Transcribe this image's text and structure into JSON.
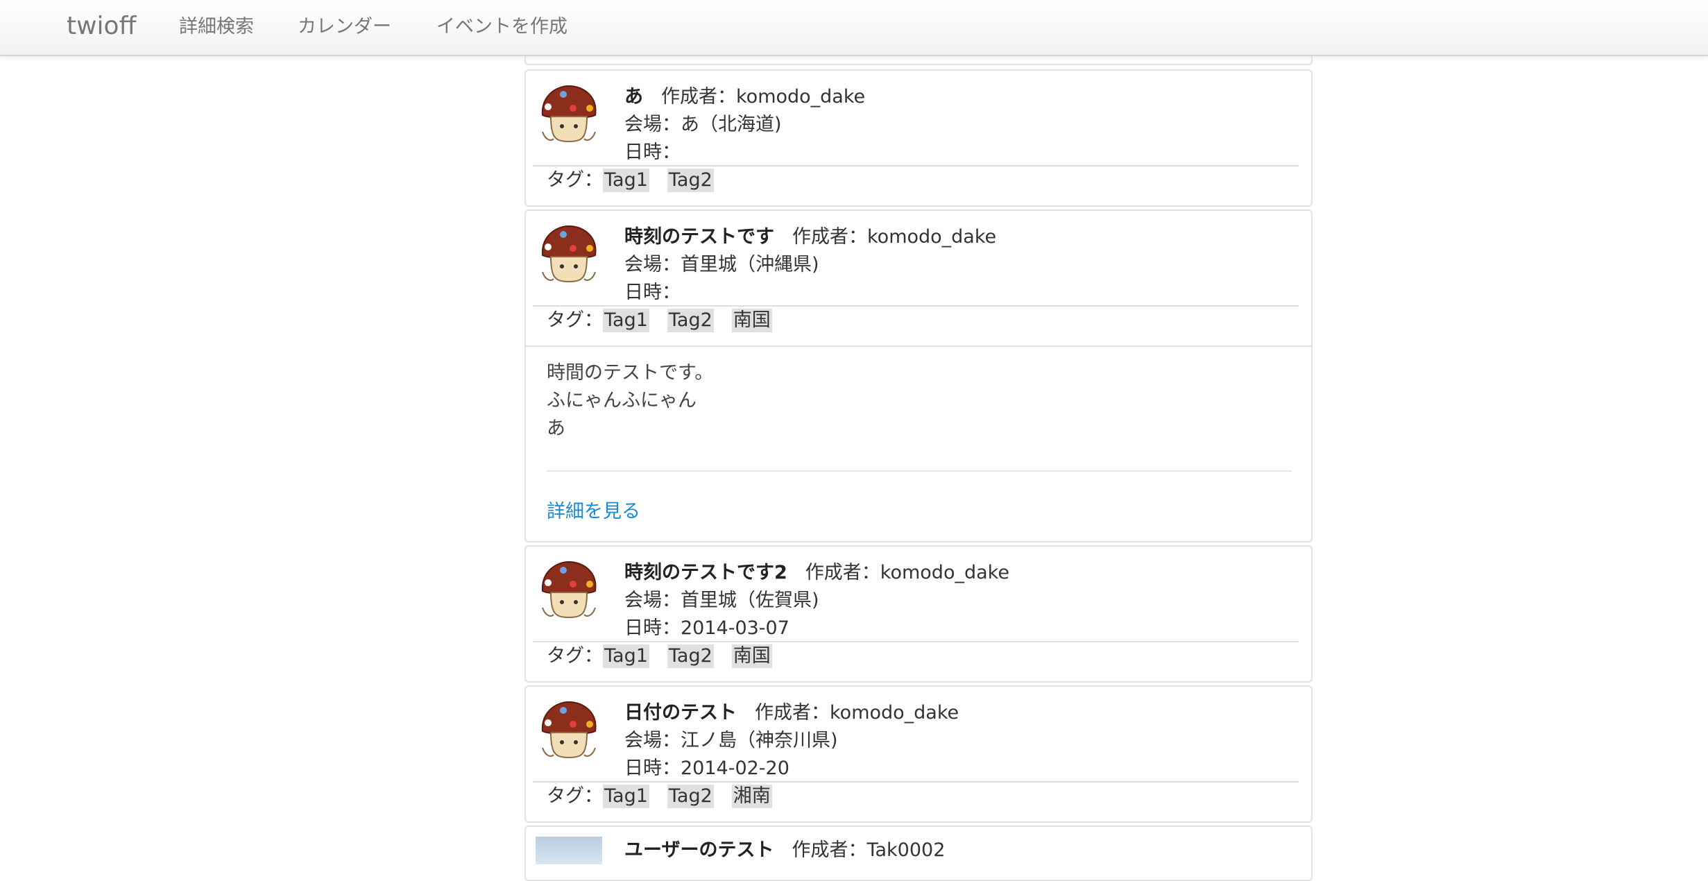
{
  "navbar": {
    "brand": "twioff",
    "items": [
      "詳細検索",
      "カレンダー",
      "イベントを作成"
    ]
  },
  "labels": {
    "author_prefix": "作成者：",
    "venue_prefix": "会場：",
    "date_prefix": "日時：",
    "tag_prefix": "タグ："
  },
  "events": [
    {
      "title": "あ",
      "author": "komodo_dake",
      "venue": "あ（北海道)",
      "date": "",
      "tags": [
        "Tag1",
        "Tag2"
      ]
    },
    {
      "title": "時刻のテストです",
      "author": "komodo_dake",
      "venue": "首里城（沖縄県)",
      "date": "",
      "tags": [
        "Tag1",
        "Tag2",
        "南国"
      ],
      "body": [
        "時間のテストです。",
        "ふにゃんふにゃん",
        "あ"
      ],
      "detail_link": "詳細を見る"
    },
    {
      "title": "時刻のテストです2",
      "author": "komodo_dake",
      "venue": "首里城（佐賀県)",
      "date": "2014-03-07",
      "tags": [
        "Tag1",
        "Tag2",
        "南国"
      ]
    },
    {
      "title": "日付のテスト",
      "author": "komodo_dake",
      "venue": "江ノ島（神奈川県)",
      "date": "2014-02-20",
      "tags": [
        "Tag1",
        "Tag2",
        "湘南"
      ]
    },
    {
      "title": "ユーザーのテスト",
      "author": "Tak0002"
    }
  ],
  "colors": {
    "link": "#1a8bd1",
    "tag_bg": "#e0e0e0",
    "nav_text": "#777777"
  },
  "icons": {
    "avatar": "mushroom-avatar-icon"
  }
}
